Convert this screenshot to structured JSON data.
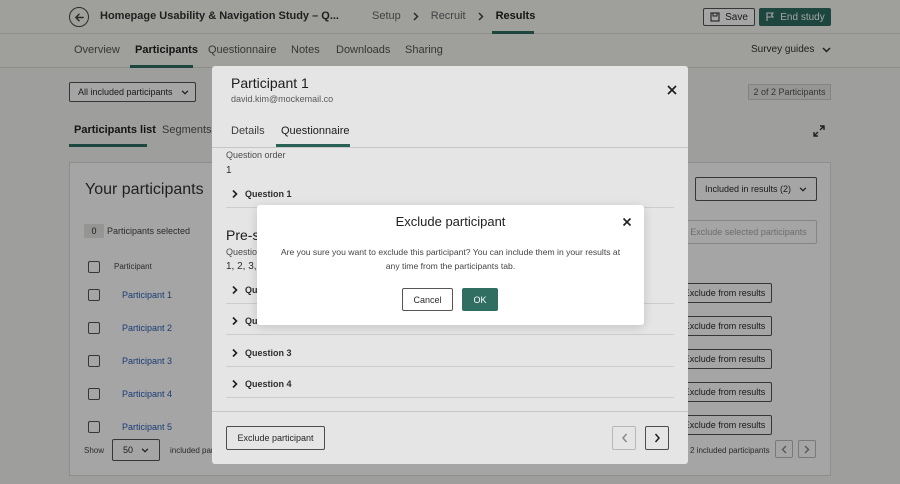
{
  "header": {
    "study_title": "Homepage Usability & Navigation Study – Q...",
    "steps": [
      "Setup",
      "Recruit",
      "Results"
    ],
    "save_label": "Save",
    "end_label": "End study"
  },
  "tabs": {
    "items": [
      "Overview",
      "Participants",
      "Questionnaire",
      "Notes",
      "Downloads",
      "Sharing"
    ],
    "survey_guides": "Survey guides"
  },
  "background": {
    "filter": "All included participants",
    "count_badge": "2 of 2 Participants",
    "sub_tabs": [
      "Participants list",
      "Segments"
    ],
    "card_title": "Your participants",
    "included_select": "Included in results (2)",
    "selected_count": "0",
    "selected_label": "Participants selected",
    "exclude_selected": "Exclude selected participants",
    "col_participant": "Participant",
    "rows": [
      {
        "name": "Participant 1",
        "action": "Exclude from results"
      },
      {
        "name": "Participant 2",
        "action": "Exclude from results"
      },
      {
        "name": "Participant 3",
        "action": "Exclude from results"
      },
      {
        "name": "Participant 4",
        "action": "Exclude from results"
      },
      {
        "name": "Participant 5",
        "action": "Exclude from results"
      }
    ],
    "show_label": "Show",
    "show_value": "50",
    "included_left": "included parti",
    "included_right": "2 included participants"
  },
  "participant_modal": {
    "name": "Participant 1",
    "email": "david.kim@mockemail.co",
    "tabs": [
      "Details",
      "Questionnaire"
    ],
    "question_order_label": "Question order",
    "question_order_value": "1",
    "question_1": "Question 1",
    "pre_heading": "Pre-s",
    "pre_sub": "Questio",
    "pre_value": "1, 2, 3,",
    "q_rows": [
      "Qu",
      "Qu",
      "Question 3",
      "Question 4"
    ],
    "exclude_button": "Exclude participant"
  },
  "confirm_dialog": {
    "title": "Exclude participant",
    "message": "Are you sure you want to exclude this participant? You can include them in your results at any time from the participants tab.",
    "cancel": "Cancel",
    "ok": "OK"
  },
  "colors": {
    "accent": "#2f6e61",
    "link": "#2a5fb6"
  }
}
